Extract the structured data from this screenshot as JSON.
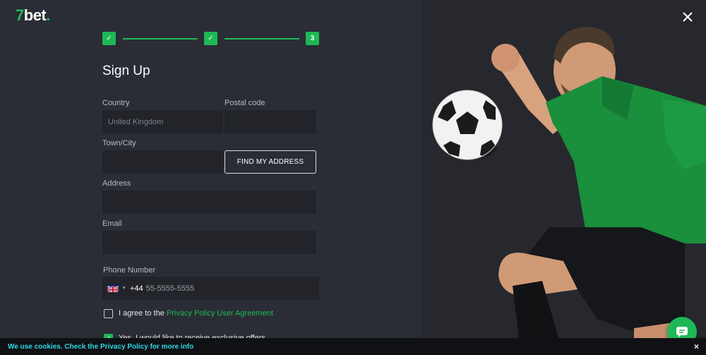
{
  "brand": {
    "logo_seven": "7",
    "logo_rest": "bet",
    "logo_dot": "."
  },
  "steps": [
    {
      "mark": "✓",
      "status": "done"
    },
    {
      "mark": "✓",
      "status": "done"
    },
    {
      "mark": "3",
      "status": "current"
    }
  ],
  "form": {
    "title": "Sign Up",
    "country_label": "Country",
    "country_value": "United Kingdom",
    "postal_label": "Postal code",
    "postal_value": "",
    "town_label": "Town/City",
    "town_value": "",
    "find_address_label": "FIND MY ADDRESS",
    "address_label": "Address",
    "address_value": "",
    "email_label": "Email",
    "email_value": "",
    "phone_label": "Phone Number",
    "phone_dial_code": "+44",
    "phone_placeholder": "55-5555-5555",
    "agree_prefix": "I agree to the ",
    "agree_link": "Privacy Policy User Agreement",
    "offers_text": "Yes, I would like to receive exclusive offers",
    "agree_checked": false,
    "offers_checked": true
  },
  "cookie": {
    "text": "We use cookies. Check the Privacy Policy for more info",
    "close": "×"
  },
  "colors": {
    "accent": "#1fb856",
    "background": "#2a2d35",
    "input_bg": "#22242a",
    "cookie_text": "#2fd8e6"
  },
  "icons": {
    "close": "close-icon",
    "chat": "chat-icon",
    "flag": "uk-flag-icon"
  }
}
